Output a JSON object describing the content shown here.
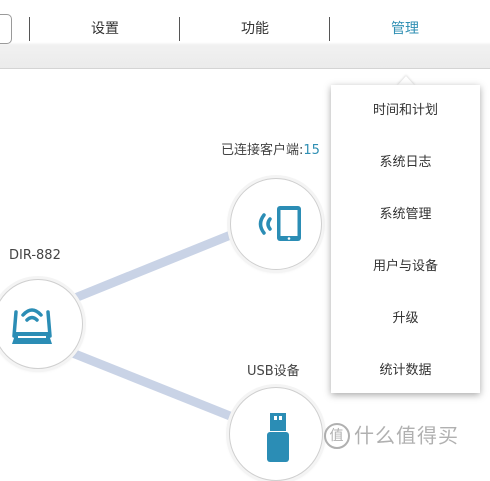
{
  "nav": {
    "tabs": [
      {
        "label": "设置",
        "active": false
      },
      {
        "label": "功能",
        "active": false
      },
      {
        "label": "管理",
        "active": true
      }
    ]
  },
  "network": {
    "router": {
      "label": "DIR-882",
      "icon": "router-icon"
    },
    "clients": {
      "label": "已连接客户端:",
      "count": "15",
      "icon": "tablet-wifi-icon"
    },
    "usb": {
      "label": "USB设备",
      "icon": "usb-drive-icon"
    }
  },
  "dropdown": {
    "items": [
      {
        "label": "时间和计划"
      },
      {
        "label": "系统日志"
      },
      {
        "label": "系统管理"
      },
      {
        "label": "用户与设备"
      },
      {
        "label": "升级"
      },
      {
        "label": "统计数据"
      }
    ]
  },
  "watermark": {
    "logo_char": "值",
    "text": "什么值得买"
  },
  "colors": {
    "accent": "#2f8fb3",
    "link_line": "#c9d3e6",
    "icon": "#2b8db5"
  }
}
